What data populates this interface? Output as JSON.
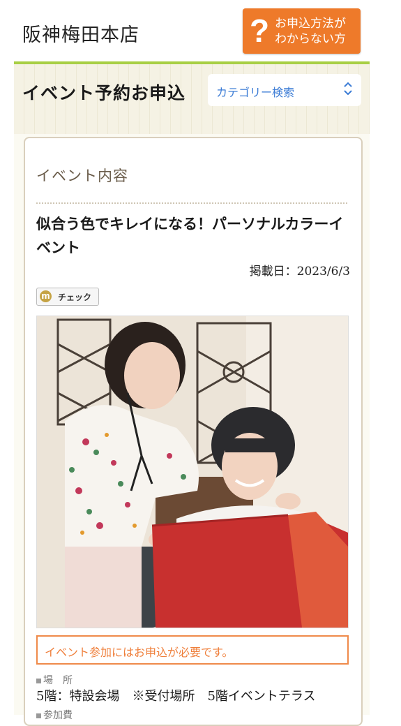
{
  "header": {
    "store_name": "阪神梅田本店",
    "help_button": {
      "line1": "お申込方法が",
      "line2": "わからない方",
      "icon": "?"
    }
  },
  "subheader": {
    "title": "イベント予約お申込",
    "category_select": {
      "label": "カテゴリー検索"
    }
  },
  "event": {
    "section_title": "イベント内容",
    "title": "似合う色でキレイになる！パーソナルカラーイベント",
    "posted_date": "掲載日：2023/6/3",
    "check_button": {
      "icon": "m",
      "label": "チェック"
    },
    "photo_alt": "",
    "notice": "イベント参加にはお申込が必要です。",
    "location": {
      "label": "場　所",
      "value": "5階：特設会場　※受付場所　5階イベントテラス"
    },
    "fee": {
      "label": "参加費"
    }
  },
  "colors": {
    "accent_green": "#a8cf45",
    "help_orange": "#ee7a2a",
    "link_blue": "#3a7bd5",
    "notice_orange": "#ef8a4a"
  }
}
